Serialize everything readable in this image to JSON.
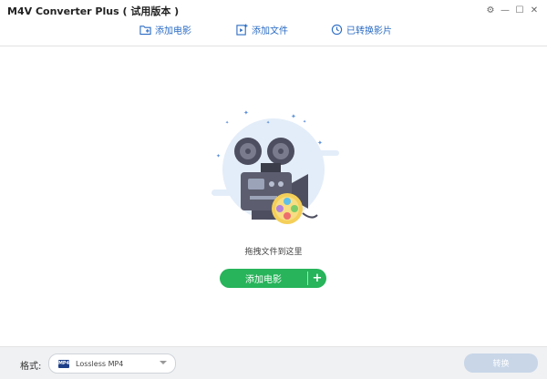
{
  "app": {
    "title": "M4V Converter Plus ( 试用版本 )"
  },
  "window_controls": {
    "settings_icon": "gear-icon",
    "minimize_icon": "minimize-icon",
    "maximize_icon": "maximize-icon",
    "close_icon": "close-icon"
  },
  "toolbar": {
    "add_movie": "添加电影",
    "add_file": "添加文件",
    "converted": "已转换影片"
  },
  "main": {
    "illustration_icon": "movie-projector-icon",
    "drop_hint": "拖拽文件到这里",
    "add_button_label": "添加电影",
    "add_plus": "+"
  },
  "bottom": {
    "format_label": "格式:",
    "format_value": "Lossless MP4",
    "format_icon_text": "MP4",
    "convert_label": "转换"
  },
  "colors": {
    "accent_blue": "#2b6cc4",
    "add_green": "#27b45a",
    "convert_disabled": "#c8d6e8"
  }
}
